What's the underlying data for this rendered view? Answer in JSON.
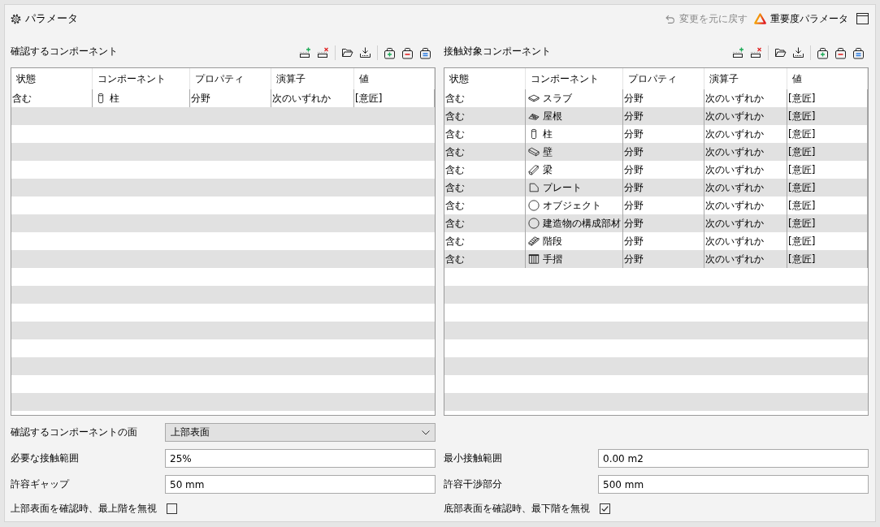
{
  "panel": {
    "title": "パラメータ",
    "undo": {
      "label": "変更を元に戻す",
      "disabled": true
    },
    "importance": {
      "label": "重要度パラメータ"
    }
  },
  "sections": [
    {
      "heading": "確認するコンポーネント",
      "table": {
        "columns": [
          "状態",
          "コンポーネント",
          "プロパティ",
          "演算子",
          "値"
        ],
        "rows": [
          {
            "status": "含む",
            "kind": "column",
            "component": "柱",
            "property": "分野",
            "operator": "次のいずれか",
            "value": "[意匠]"
          }
        ]
      }
    },
    {
      "heading": "接触対象コンポーネント",
      "table": {
        "columns": [
          "状態",
          "コンポーネント",
          "プロパティ",
          "演算子",
          "値"
        ],
        "rows": [
          {
            "status": "含む",
            "kind": "slab",
            "component": "スラブ",
            "property": "分野",
            "operator": "次のいずれか",
            "value": "[意匠]"
          },
          {
            "status": "含む",
            "kind": "roof",
            "component": "屋根",
            "property": "分野",
            "operator": "次のいずれか",
            "value": "[意匠]"
          },
          {
            "status": "含む",
            "kind": "column",
            "component": "柱",
            "property": "分野",
            "operator": "次のいずれか",
            "value": "[意匠]"
          },
          {
            "status": "含む",
            "kind": "wall",
            "component": "壁",
            "property": "分野",
            "operator": "次のいずれか",
            "value": "[意匠]"
          },
          {
            "status": "含む",
            "kind": "beam",
            "component": "梁",
            "property": "分野",
            "operator": "次のいずれか",
            "value": "[意匠]"
          },
          {
            "status": "含む",
            "kind": "plate",
            "component": "プレート",
            "property": "分野",
            "operator": "次のいずれか",
            "value": "[意匠]"
          },
          {
            "status": "含む",
            "kind": "object",
            "component": "オブジェクト",
            "property": "分野",
            "operator": "次のいずれか",
            "value": "[意匠]"
          },
          {
            "status": "含む",
            "kind": "element",
            "component": "建造物の構成部材",
            "property": "分野",
            "operator": "次のいずれか",
            "value": "[意匠]"
          },
          {
            "status": "含む",
            "kind": "stair",
            "component": "階段",
            "property": "分野",
            "operator": "次のいずれか",
            "value": "[意匠]"
          },
          {
            "status": "含む",
            "kind": "railing",
            "component": "手摺",
            "property": "分野",
            "operator": "次のいずれか",
            "value": "[意匠]"
          }
        ]
      }
    }
  ],
  "form": {
    "left": [
      {
        "kind": "select",
        "label": "確認するコンポーネントの面",
        "value": "上部表面"
      },
      {
        "kind": "input",
        "label": "必要な接触範囲",
        "value": "25%"
      },
      {
        "kind": "input",
        "label": "許容ギャップ",
        "value": "50 mm"
      },
      {
        "kind": "checkbox",
        "label": "上部表面を確認時、最上階を無視",
        "checked": false
      }
    ],
    "right": [
      {
        "kind": "input",
        "label": "最小接触範囲",
        "value": "0.00 m2"
      },
      {
        "kind": "input",
        "label": "許容干渉部分",
        "value": "500 mm"
      },
      {
        "kind": "checkbox",
        "label": "底部表面を確認時、最下階を無視",
        "checked": true
      }
    ]
  }
}
